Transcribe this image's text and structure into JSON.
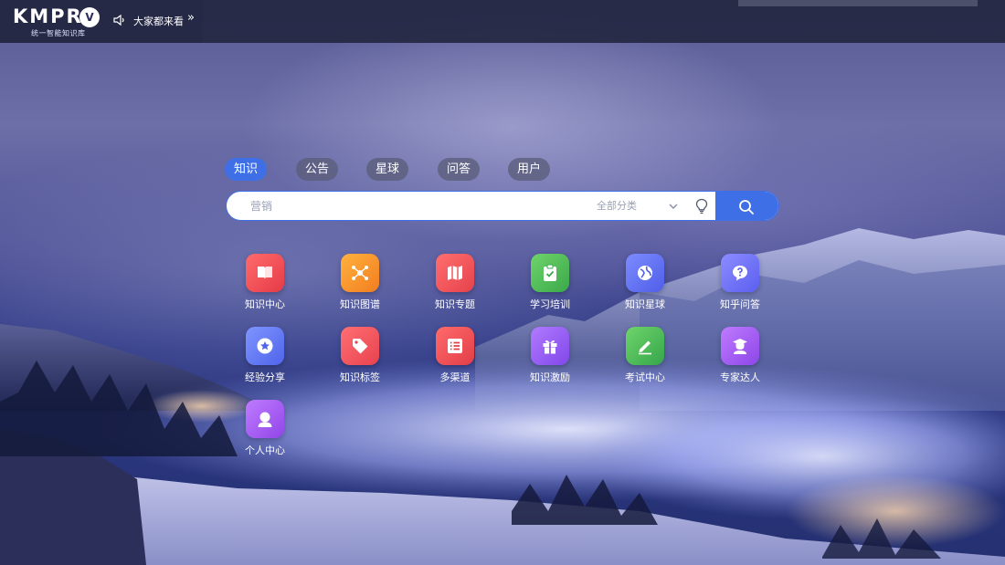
{
  "header": {
    "logo_text": "KMPRO",
    "logo_badge": "V",
    "logo_subtitle": "统一智能知识库",
    "notice_text": "大家都来看",
    "notice_more": "»"
  },
  "tabs": [
    {
      "label": "知识",
      "active": true
    },
    {
      "label": "公告",
      "active": false
    },
    {
      "label": "星球",
      "active": false
    },
    {
      "label": "问答",
      "active": false
    },
    {
      "label": "用户",
      "active": false
    }
  ],
  "search": {
    "placeholder": "营销",
    "category_label": "全部分类"
  },
  "apps": [
    {
      "label": "知识中心",
      "icon": "book-icon",
      "color_from": "#ff6b6b",
      "color_to": "#e63b48"
    },
    {
      "label": "知识图谱",
      "icon": "graph-icon",
      "color_from": "#ffb23f",
      "color_to": "#f27d1f"
    },
    {
      "label": "知识专题",
      "icon": "map-icon",
      "color_from": "#ff6f6f",
      "color_to": "#e6424c"
    },
    {
      "label": "学习培训",
      "icon": "clipboard-check-icon",
      "color_from": "#6fd46b",
      "color_to": "#3aa84a"
    },
    {
      "label": "知识星球",
      "icon": "globe-icon",
      "color_from": "#7d8cff",
      "color_to": "#4f5ee8"
    },
    {
      "label": "知乎问答",
      "icon": "question-icon",
      "color_from": "#8c8cff",
      "color_to": "#5b5ff0"
    },
    {
      "label": "经验分享",
      "icon": "star-badge-icon",
      "color_from": "#7f95ff",
      "color_to": "#4f64ea"
    },
    {
      "label": "知识标签",
      "icon": "tag-icon",
      "color_from": "#ff6f72",
      "color_to": "#e8424f"
    },
    {
      "label": "多渠道",
      "icon": "list-icon",
      "color_from": "#ff6b6b",
      "color_to": "#e23e48"
    },
    {
      "label": "知识激励",
      "icon": "gift-icon",
      "color_from": "#b07bff",
      "color_to": "#8247ea"
    },
    {
      "label": "考试中心",
      "icon": "pencil-icon",
      "color_from": "#6fd46b",
      "color_to": "#35a64a"
    },
    {
      "label": "专家达人",
      "icon": "expert-icon",
      "color_from": "#c07bff",
      "color_to": "#8c46e8"
    },
    {
      "label": "个人中心",
      "icon": "user-icon",
      "color_from": "#c07bff",
      "color_to": "#9046e8"
    }
  ]
}
